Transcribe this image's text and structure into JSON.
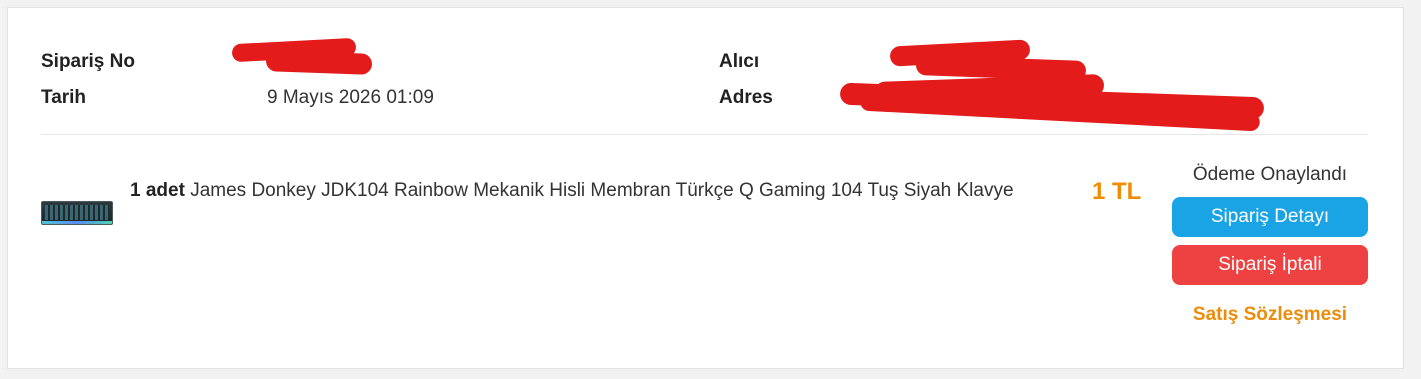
{
  "order": {
    "order_no_label": "Sipariş No",
    "date_label": "Tarih",
    "date_value": "9 Mayıs 2026 01:09",
    "recipient_label": "Alıcı",
    "address_label": "Adres"
  },
  "item": {
    "quantity": "1 adet",
    "title": "James Donkey JDK104 Rainbow Mekanik Hisli Membran Türkçe Q Gaming 104 Tuş Siyah Klavye",
    "price": "1 TL",
    "image_icon": "keyboard-icon"
  },
  "actions": {
    "status": "Ödeme Onaylandı",
    "detail_button": "Sipariş Detayı",
    "cancel_button": "Sipariş İptali",
    "contract_link": "Satış Sözleşmesi"
  },
  "colors": {
    "price": "#f08c00",
    "detail_button": "#1aa3e5",
    "cancel_button": "#ee4242",
    "contract_link": "#ec8c0a",
    "redaction": "#e41b1b"
  }
}
